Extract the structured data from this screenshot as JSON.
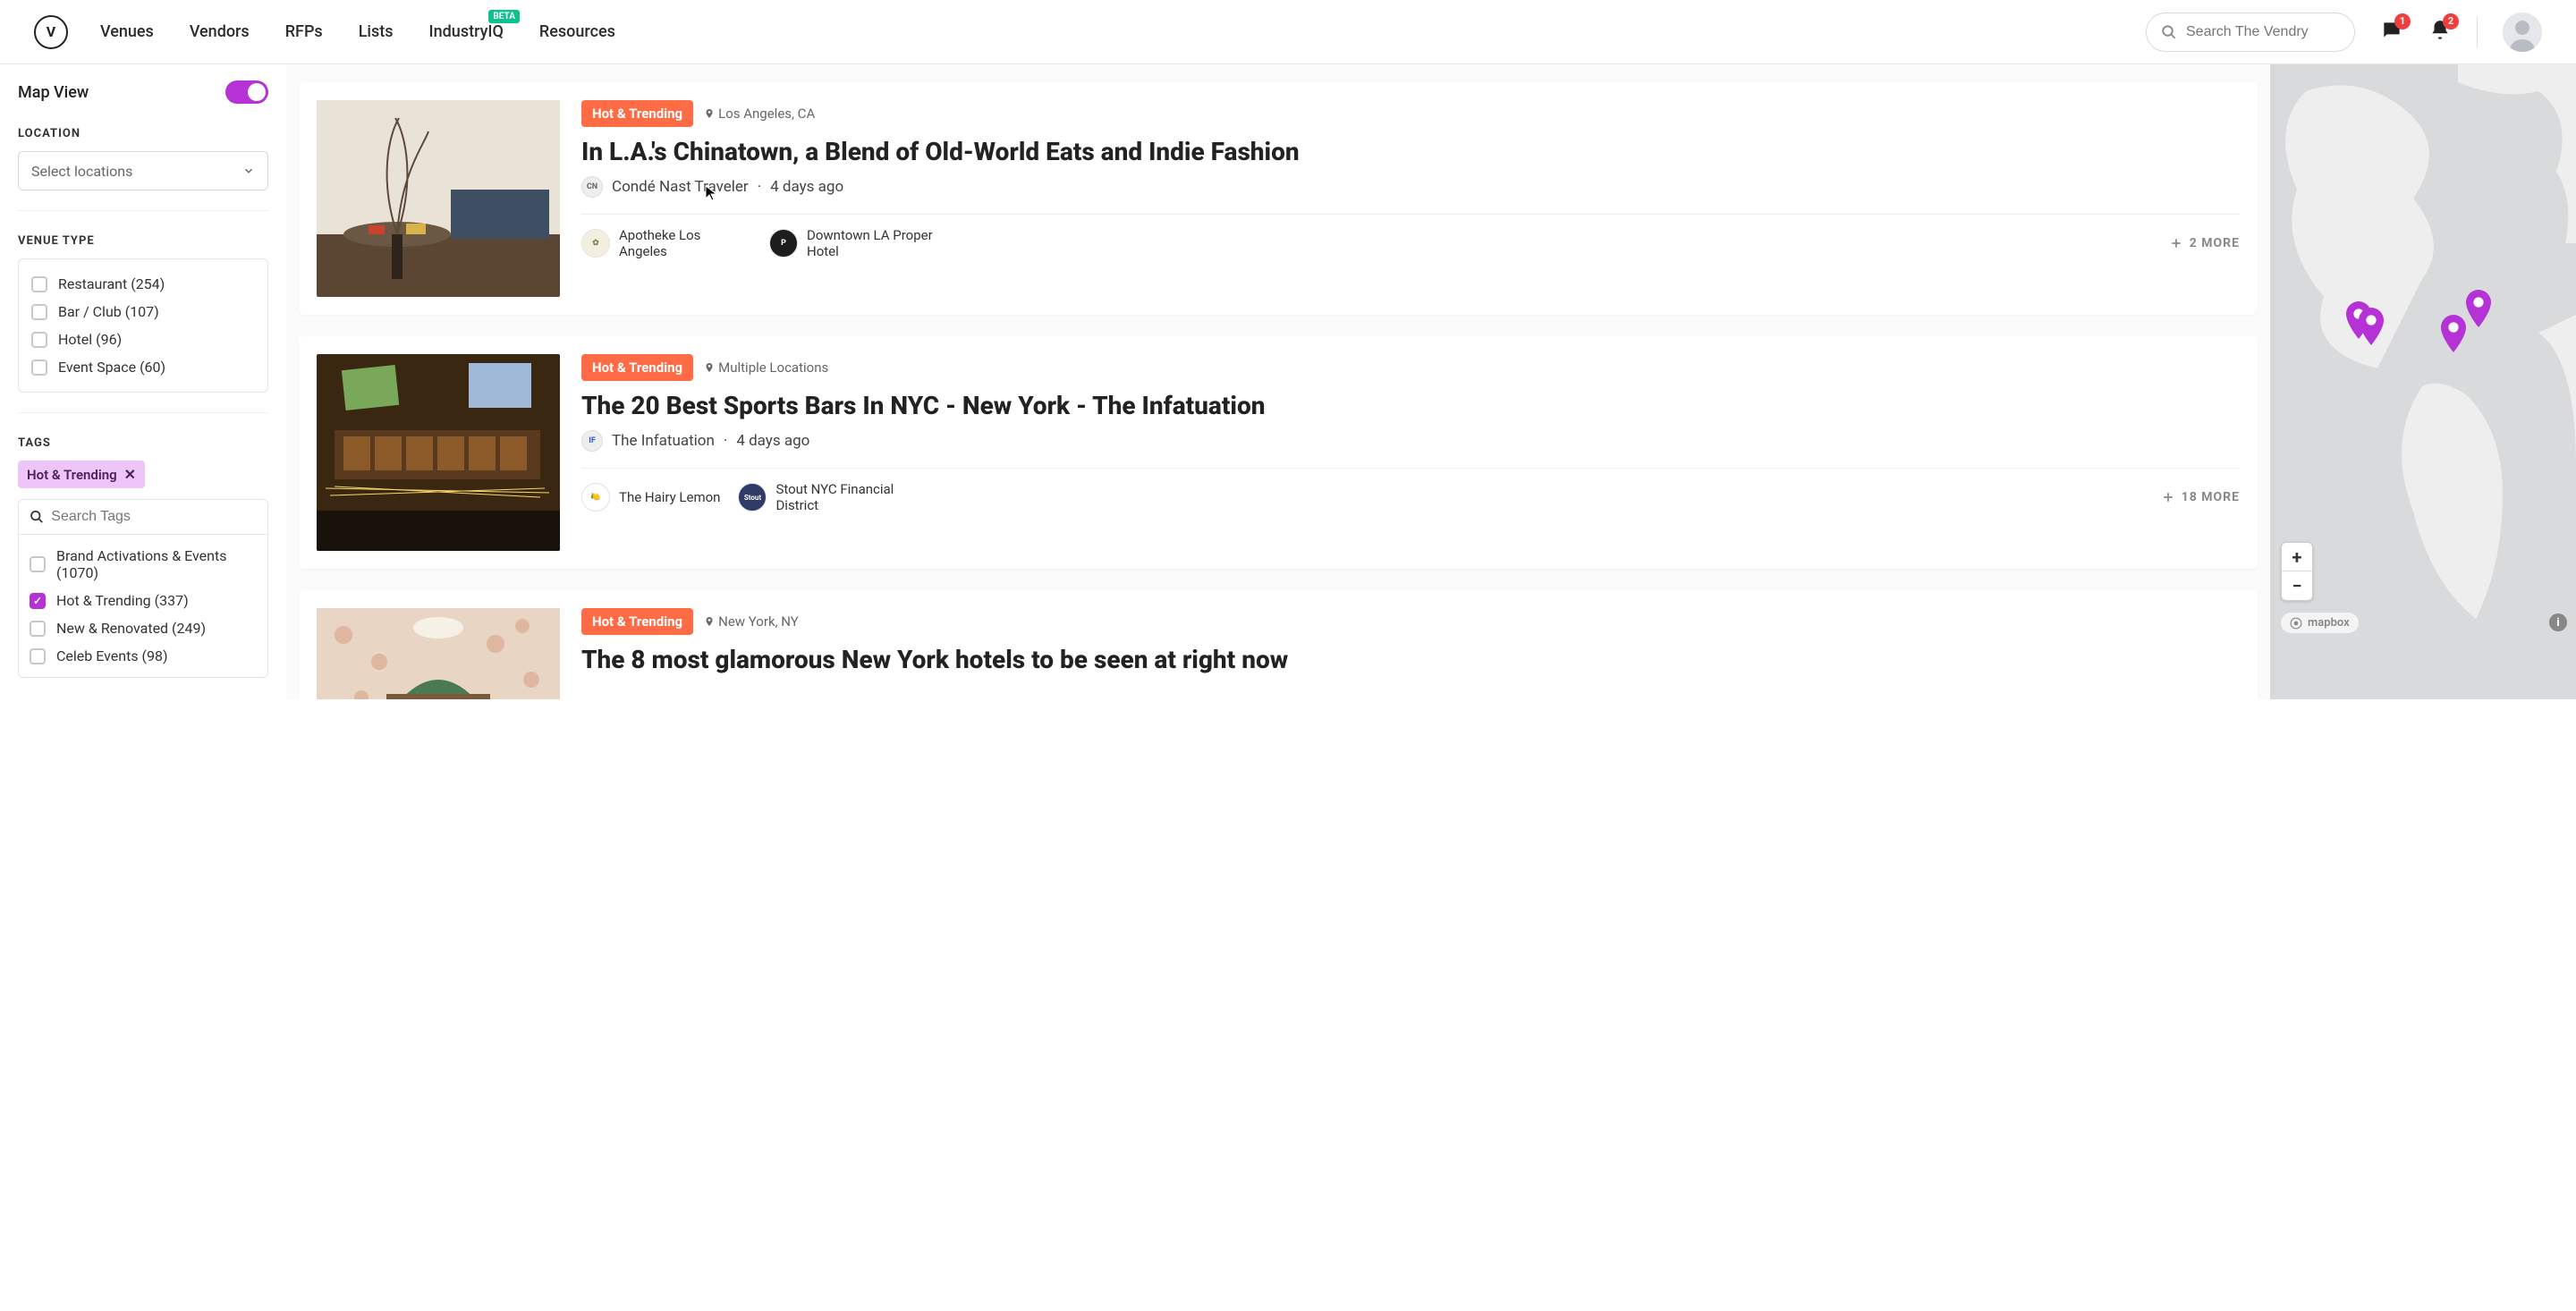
{
  "header": {
    "logo_letter": "V",
    "nav": [
      "Venues",
      "Vendors",
      "RFPs",
      "Lists",
      "IndustryIQ",
      "Resources"
    ],
    "beta_badge": "BETA",
    "search_placeholder": "Search The Vendry",
    "messages_badge": "1",
    "notifications_badge": "2"
  },
  "sidebar": {
    "map_view_label": "Map View",
    "map_view_on": true,
    "location_title": "LOCATION",
    "location_select_placeholder": "Select locations",
    "venue_type_title": "VENUE TYPE",
    "venue_types": [
      {
        "label": "Restaurant (254)",
        "checked": false
      },
      {
        "label": "Bar / Club (107)",
        "checked": false
      },
      {
        "label": "Hotel (96)",
        "checked": false
      },
      {
        "label": "Event Space (60)",
        "checked": false
      }
    ],
    "tags_title": "TAGS",
    "active_tag": "Hot & Trending",
    "tag_search_placeholder": "Search Tags",
    "tag_options": [
      {
        "label": "Brand Activations & Events (1070)",
        "checked": false
      },
      {
        "label": "Hot & Trending (337)",
        "checked": true
      },
      {
        "label": "New & Renovated (249)",
        "checked": false
      },
      {
        "label": "Celeb Events (98)",
        "checked": false
      }
    ]
  },
  "cards": [
    {
      "tag": "Hot & Trending",
      "location": "Los Angeles, CA",
      "title": "In L.A.'s Chinatown, a Blend of Old-World Eats and Indie Fashion",
      "source": "Condé Nast Traveler",
      "time": "4 days ago",
      "venues": [
        {
          "name": "Apotheke Los Angeles"
        },
        {
          "name": "Downtown LA Proper Hotel"
        }
      ],
      "more": "2 MORE"
    },
    {
      "tag": "Hot & Trending",
      "location": "Multiple Locations",
      "title": "The 20 Best Sports Bars In NYC - New York - The Infatuation",
      "source": "The Infatuation",
      "time": "4 days ago",
      "venues": [
        {
          "name": "The Hairy Lemon"
        },
        {
          "name": "Stout NYC Financial District"
        }
      ],
      "more": "18 MORE"
    },
    {
      "tag": "Hot & Trending",
      "location": "New York, NY",
      "title": "The 8 most glamorous New York hotels to be seen at right now",
      "source": "",
      "time": "",
      "venues": [],
      "more": ""
    }
  ],
  "map": {
    "zoom_in": "+",
    "zoom_out": "−",
    "provider": "mapbox",
    "info": "i"
  }
}
